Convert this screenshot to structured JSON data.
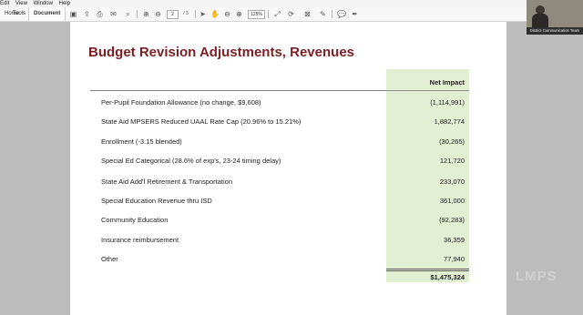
{
  "menu": [
    "Edit",
    "View",
    "Window",
    "Help"
  ],
  "tabs": [
    "Home",
    "Tools",
    "Document"
  ],
  "toolbar": {
    "page_current": "2",
    "page_total": "/ 3",
    "zoom": "125%"
  },
  "slide": {
    "title": "Budget Revision Adjustments, Revenues",
    "column_header": "Net Impact",
    "rows": [
      {
        "label": "Per-Pupil Foundation Allowance (no change, $9,608)",
        "value": "(1,114,991)"
      },
      {
        "label": "State Aid MPSERS Reduced UAAL Rate Cap (20.96% to 15.21%)",
        "value": "1,882,774"
      },
      {
        "label": "Enrollment (-3.15 blended)",
        "value": "(30,265)"
      },
      {
        "label": "Special Ed Categorical (28.6% of exp's, 23-24 timing delay)",
        "value": "121,720"
      },
      {
        "label": "State Aid Add'l Retirement & Transportation",
        "value": "233,070"
      },
      {
        "label": "Special Education Revenue thru ISD",
        "value": "361,000"
      },
      {
        "label": "Community Education",
        "value": "(92,283)"
      },
      {
        "label": "Insurance reimbursement",
        "value": "36,359"
      },
      {
        "label": "Other",
        "value": "77,940"
      }
    ],
    "total": "$1,475,324"
  },
  "video": {
    "caption": "District Communication Team"
  },
  "watermark": "LMPS"
}
